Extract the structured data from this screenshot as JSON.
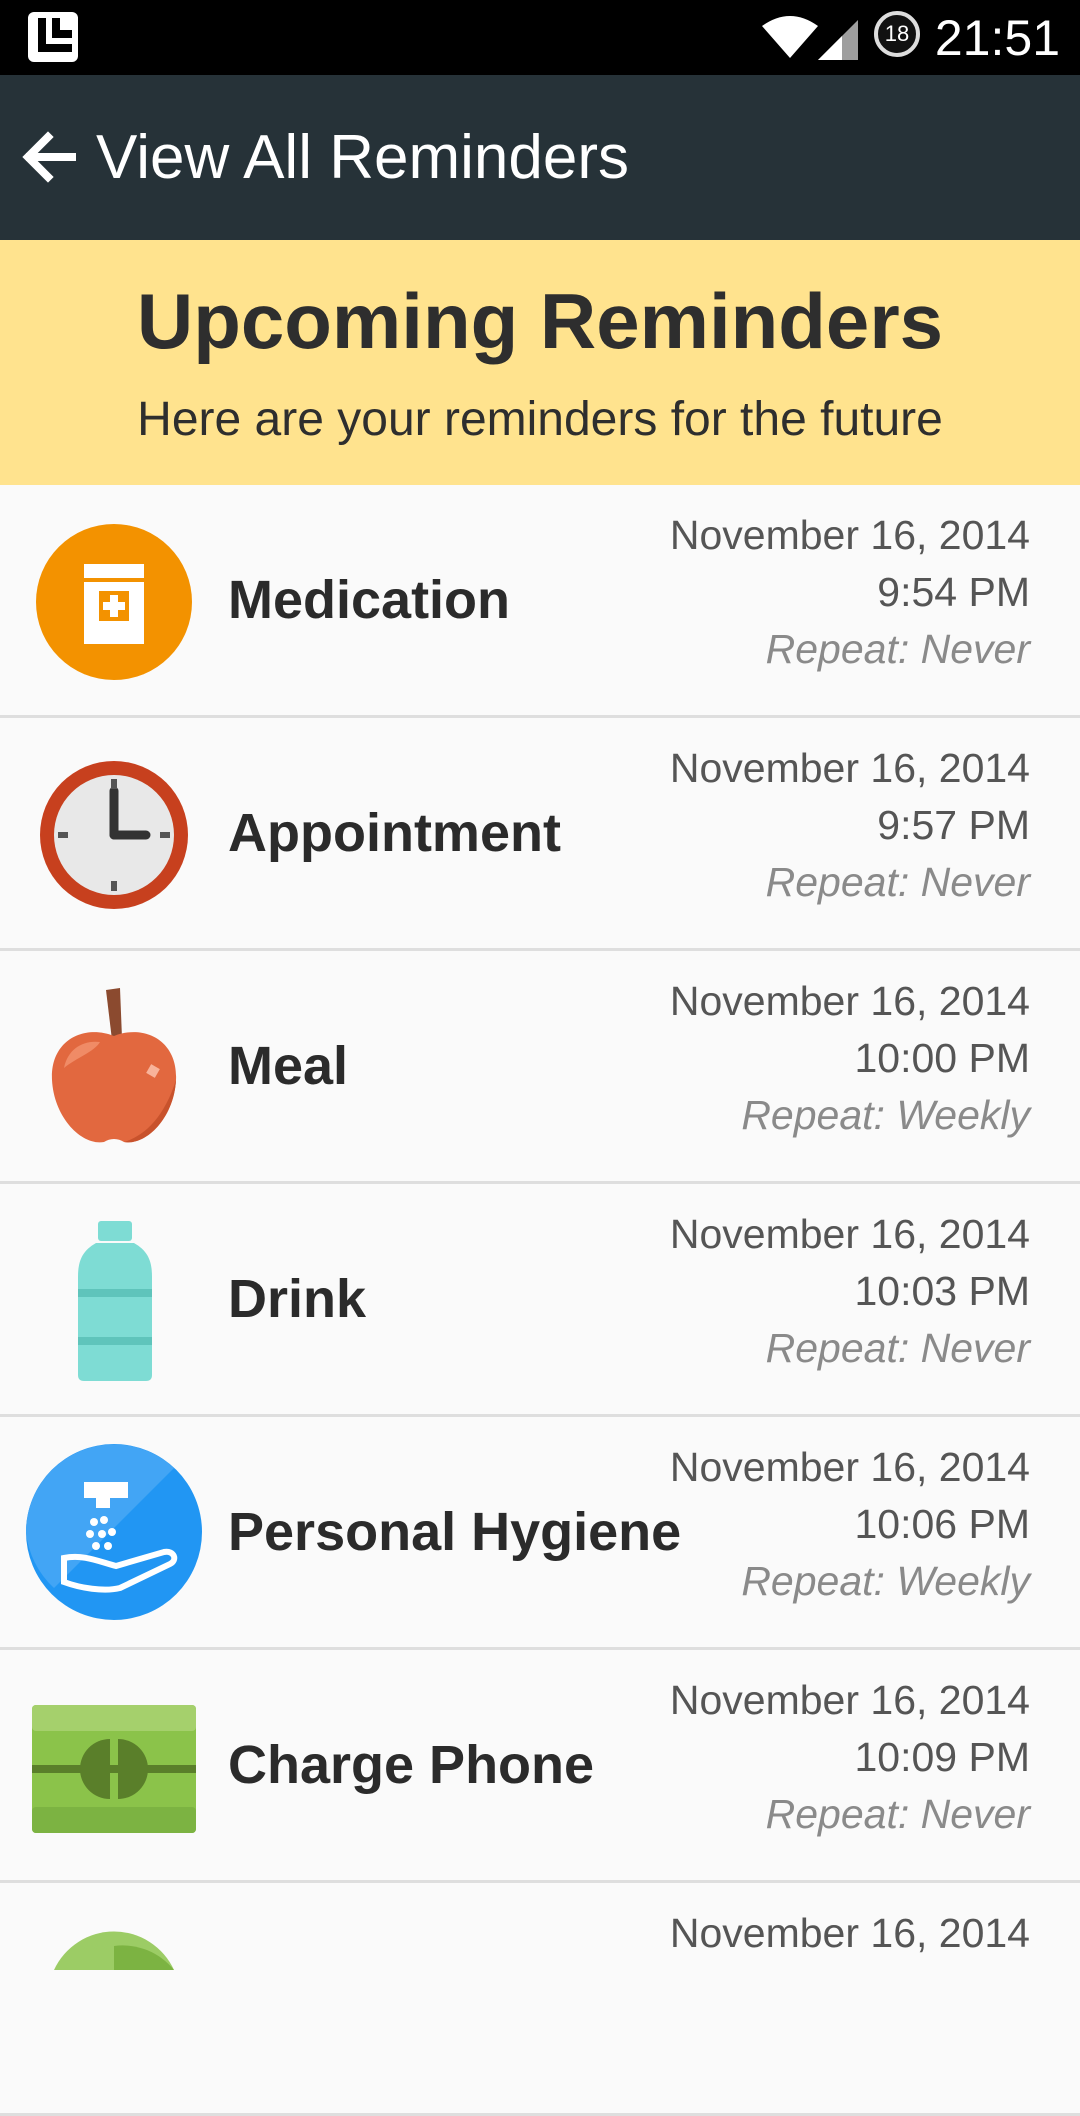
{
  "status_bar": {
    "time": "21:51",
    "notification_count": "18",
    "icons": [
      "app-icon",
      "wifi-icon",
      "signal-icon"
    ]
  },
  "app_bar": {
    "back_icon": "arrow-left-icon",
    "title": "View All Reminders"
  },
  "banner": {
    "heading": "Upcoming Reminders",
    "subheading": "Here are your reminders for the future"
  },
  "reminders": [
    {
      "name": "Medication",
      "date": "November 16, 2014",
      "time": "9:54 PM",
      "repeat": "Repeat: Never",
      "icon": "medication-icon"
    },
    {
      "name": "Appointment",
      "date": "November 16, 2014",
      "time": "9:57 PM",
      "repeat": "Repeat: Never",
      "icon": "clock-icon"
    },
    {
      "name": "Meal",
      "date": "November 16, 2014",
      "time": "10:00 PM",
      "repeat": "Repeat: Weekly",
      "icon": "apple-icon"
    },
    {
      "name": "Drink",
      "date": "November 16, 2014",
      "time": "10:03 PM",
      "repeat": "Repeat: Never",
      "icon": "water-bottle-icon"
    },
    {
      "name": "Personal Hygiene",
      "date": "November 16, 2014",
      "time": "10:06 PM",
      "repeat": "Repeat: Weekly",
      "icon": "hand-washing-icon"
    },
    {
      "name": "Charge Phone",
      "date": "November 16, 2014",
      "time": "10:09 PM",
      "repeat": "Repeat: Never",
      "icon": "battery-plug-icon"
    },
    {
      "name": "",
      "date": "November 16, 2014",
      "time": "",
      "repeat": "",
      "icon": "partial-icon"
    }
  ],
  "colors": {
    "app_bar": "#263238",
    "banner": "#ffe38e",
    "medication": "#f39200",
    "hygiene": "#2196f3",
    "bottle": "#7edcd4",
    "apple": "#e2683f",
    "charge": "#8bc34a"
  }
}
